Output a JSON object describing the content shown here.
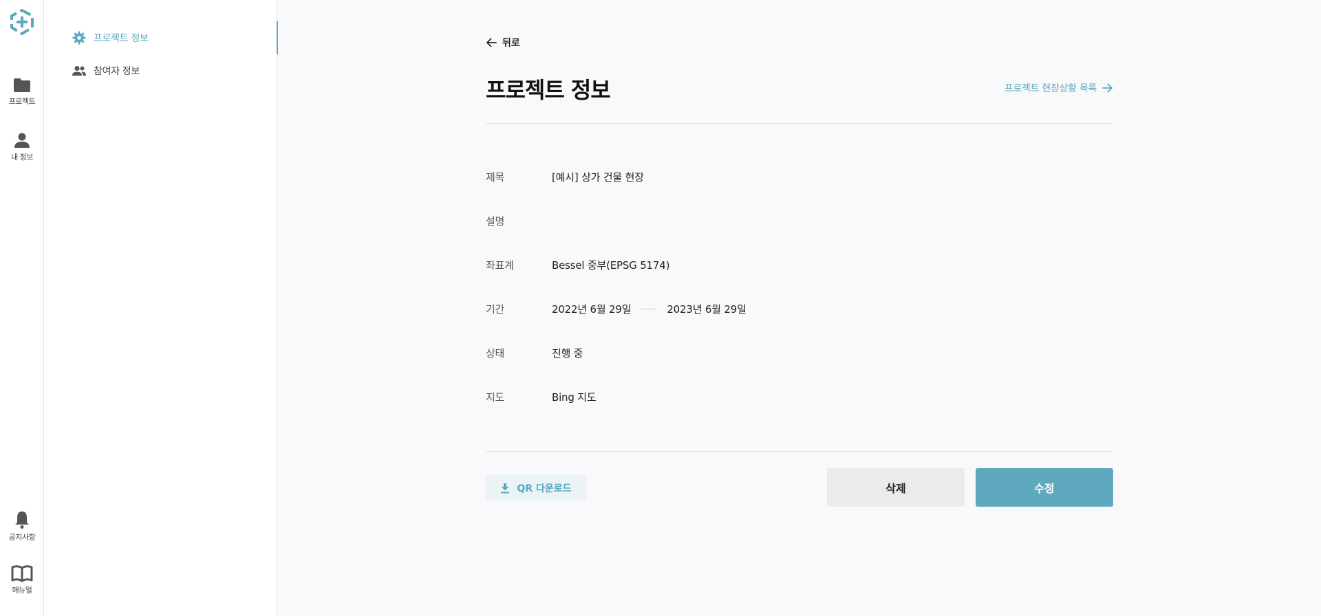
{
  "colors": {
    "accent": "#5aa8bd",
    "primary_button": "#5fa9bf",
    "secondary_button": "#ebebeb",
    "qr_button_bg": "#eaf3f6",
    "icon_gray": "#555555"
  },
  "rail": {
    "logo_icon": "app-logo-icon",
    "items": [
      {
        "label": "프로젝트",
        "icon": "folder-icon"
      },
      {
        "label": "내 정보",
        "icon": "person-icon"
      },
      {
        "label": "공지사항",
        "icon": "bell-icon"
      },
      {
        "label": "매뉴얼",
        "icon": "book-icon"
      }
    ]
  },
  "sidebar": {
    "items": [
      {
        "label": "프로젝트 정보",
        "icon": "gear-icon",
        "active": true
      },
      {
        "label": "참여자 정보",
        "icon": "people-icon",
        "active": false
      }
    ]
  },
  "main": {
    "back_label": "뒤로",
    "title": "프로젝트 정보",
    "site_list_link": "프로젝트 현장상황 목록",
    "fields": {
      "title": {
        "label": "제목",
        "value": "[예시] 상가 건물 현장"
      },
      "description": {
        "label": "설명",
        "value": ""
      },
      "crs": {
        "label": "좌표계",
        "value": "Bessel 중부(EPSG 5174)"
      },
      "period": {
        "label": "기간",
        "start": "2022년 6월 29일",
        "end": "2023년 6월 29일"
      },
      "status": {
        "label": "상태",
        "value": "진행 중"
      },
      "map": {
        "label": "지도",
        "value": "Bing 지도"
      }
    },
    "qr_download_label": "QR 다운로드",
    "delete_label": "삭제",
    "edit_label": "수정"
  }
}
